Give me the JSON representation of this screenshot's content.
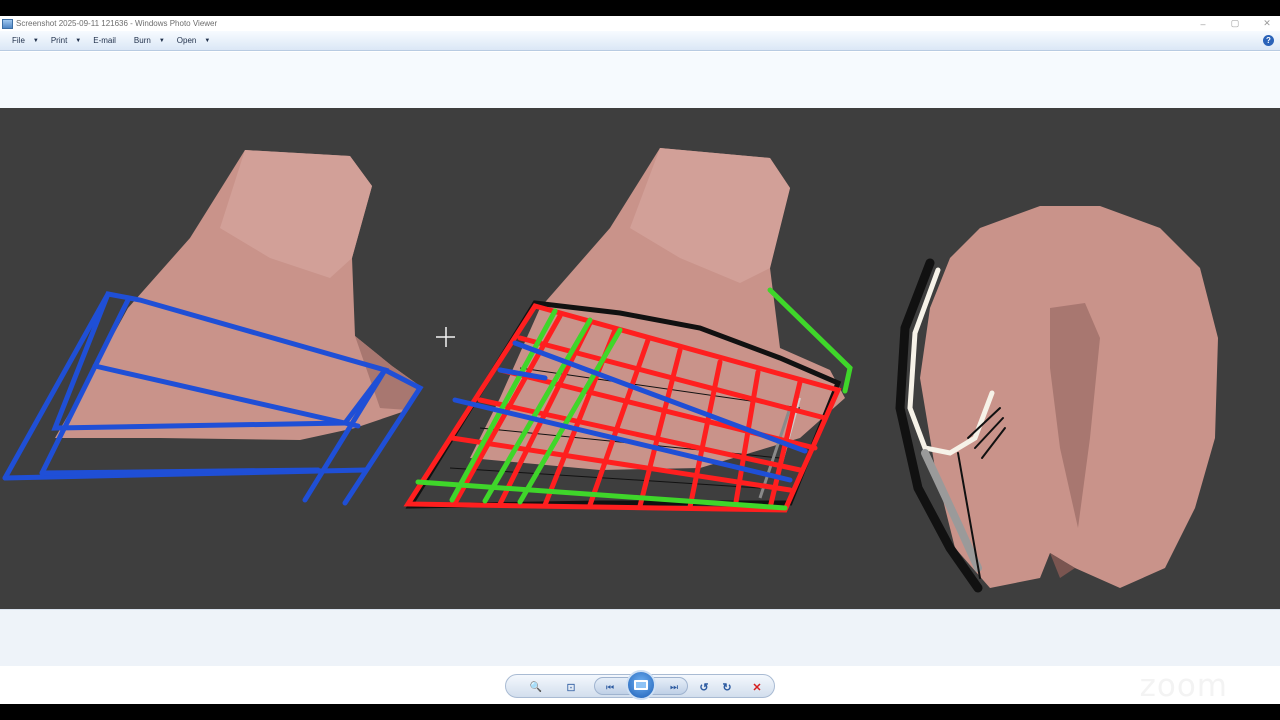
{
  "window": {
    "title": "Screenshot 2025-09-11 121636 - Windows Photo Viewer",
    "controls": [
      "–",
      "▢",
      "✕"
    ]
  },
  "menubar": {
    "items": [
      {
        "label": "File",
        "has_dropdown": true
      },
      {
        "label": "Print",
        "has_dropdown": true
      },
      {
        "label": "E-mail",
        "has_dropdown": false
      },
      {
        "label": "Burn",
        "has_dropdown": true
      },
      {
        "label": "Open",
        "has_dropdown": true
      }
    ],
    "help_label": "?"
  },
  "toolbar": {
    "zoom_glyph": "🔍",
    "actual_size_glyph": "⊡",
    "previous_glyph": "⏮",
    "next_glyph": "⏭",
    "rotate_ccw_glyph": "↺",
    "rotate_cw_glyph": "↻",
    "delete_glyph": "✕"
  },
  "watermark": {
    "text": "zoom"
  },
  "colors": {
    "viewer_bg": "#3e3e3e",
    "skin": "#c9938a",
    "red_grid": "#ff1f1f",
    "green_grid": "#3fd62a",
    "blue_grid": "#1f4fd6",
    "delete_red": "#d61f1f"
  }
}
